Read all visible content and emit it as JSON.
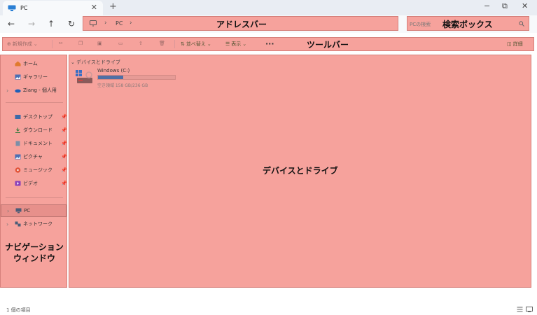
{
  "window": {
    "tab_title": "PC",
    "new_tab": "+",
    "tab_close": "✕",
    "minimize": "−",
    "maximize": "⧉",
    "close": "✕"
  },
  "nav": {
    "back": "←",
    "forward": "→",
    "up": "↑",
    "refresh": "↻"
  },
  "address": {
    "sep": "›",
    "crumb": "PC",
    "overlay_label": "アドレスバー"
  },
  "search": {
    "placeholder": "PCの検索",
    "overlay_label": "検索ボックス"
  },
  "toolbar": {
    "new_label": "新規作成",
    "sort_label": "並べ替え",
    "view_label": "表示",
    "more": "···",
    "details_label": "詳細",
    "overlay_label": "ツールバー"
  },
  "navpane": {
    "items": [
      {
        "label": "ホーム",
        "icon": "home-icon"
      },
      {
        "label": "ギャラリー",
        "icon": "gallery-icon"
      },
      {
        "label": "Ziang - 個人用",
        "icon": "onedrive-icon"
      },
      {
        "label": "デスクトップ",
        "icon": "desktop-icon",
        "pinned": true
      },
      {
        "label": "ダウンロード",
        "icon": "download-icon",
        "pinned": true
      },
      {
        "label": "ドキュメント",
        "icon": "document-icon",
        "pinned": true
      },
      {
        "label": "ピクチャ",
        "icon": "pictures-icon",
        "pinned": true
      },
      {
        "label": "ミュージック",
        "icon": "music-icon",
        "pinned": true
      },
      {
        "label": "ビデオ",
        "icon": "video-icon",
        "pinned": true
      },
      {
        "label": "PC",
        "icon": "pc-icon",
        "selected": true
      },
      {
        "label": "ネットワーク",
        "icon": "network-icon"
      }
    ],
    "overlay_label_1": "ナビゲーション",
    "overlay_label_2": "ウィンドウ"
  },
  "content": {
    "group_header": "デバイスとドライブ",
    "drive": {
      "name": "Windows (C:)",
      "free_text": "空き領域 158 GB/236 GB",
      "used_fraction": 0.33
    },
    "overlay_label": "デバイスとドライブ"
  },
  "status": {
    "item_count": "1 個の項目"
  },
  "colors": {
    "overlay": "#f6a29c",
    "overlay_border": "#d6807b",
    "drive_bar": "#4f6fa5"
  }
}
